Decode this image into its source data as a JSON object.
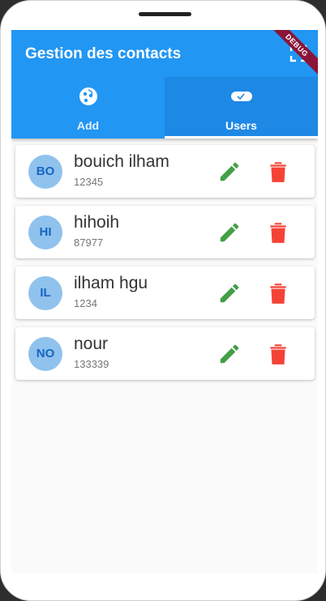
{
  "appbar": {
    "title": "Gestion des contacts",
    "debug_label": "DEBUG",
    "color": "#2196f3"
  },
  "tabs": [
    {
      "label": "Add",
      "icon": "face-icon",
      "active": false
    },
    {
      "label": "Users",
      "icon": "toggle-icon",
      "active": true
    }
  ],
  "contacts": [
    {
      "initials": "BO",
      "name": "bouich ilham",
      "phone": "12345"
    },
    {
      "initials": "HI",
      "name": "hihoih",
      "phone": "87977"
    },
    {
      "initials": "IL",
      "name": "ilham hgu",
      "phone": "1234"
    },
    {
      "initials": "NO",
      "name": "nour",
      "phone": "133339"
    }
  ],
  "colors": {
    "edit": "#43a047",
    "delete": "#f44336",
    "avatar_bg": "#90c2ee",
    "avatar_text": "#1565c0"
  }
}
